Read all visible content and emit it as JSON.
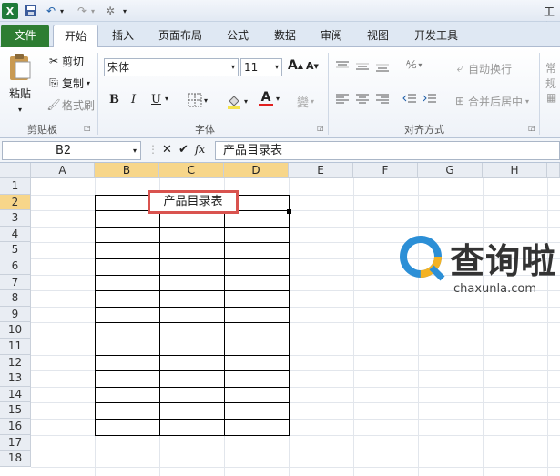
{
  "qat": {
    "logo": "X",
    "title": "工作"
  },
  "tabs": [
    "文件",
    "开始",
    "插入",
    "页面布局",
    "公式",
    "数据",
    "审阅",
    "视图",
    "开发工具"
  ],
  "clipboard": {
    "paste": "粘贴",
    "cut": "剪切",
    "copy": "复制",
    "format_painter": "格式刷",
    "group": "剪贴板"
  },
  "font": {
    "name": "宋体",
    "size": "11",
    "group": "字体",
    "bold": "B",
    "italic": "I",
    "underline": "U",
    "grow": "A",
    "shrink": "A"
  },
  "align": {
    "wrap": "自动换行",
    "merge": "合并后居中",
    "group": "对齐方式",
    "more": "常规"
  },
  "formula_bar": {
    "name_box": "B2",
    "fx": "fx",
    "content": "产品目录表"
  },
  "columns": [
    "A",
    "B",
    "C",
    "D",
    "E",
    "F",
    "G",
    "H"
  ],
  "rows": [
    "1",
    "2",
    "3",
    "4",
    "5",
    "6",
    "7",
    "8",
    "9",
    "10",
    "11",
    "12",
    "13",
    "14",
    "15",
    "16",
    "17",
    "18"
  ],
  "cell_b2": "产品目录表",
  "watermark": {
    "brand": "查询啦",
    "url": "chaxunla.com"
  },
  "colors": {
    "file_tab": "#2e7d32",
    "selection": "#f7d68a",
    "highlight": "#d9534f"
  }
}
